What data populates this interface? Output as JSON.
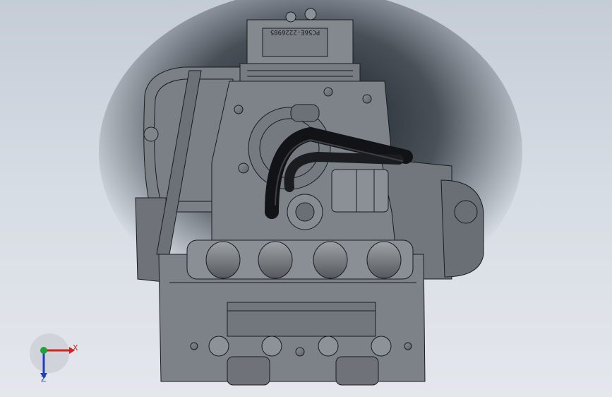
{
  "viewport": {
    "part_label": "PC56E-2226985"
  },
  "triad": {
    "x_label": "X",
    "z_label": "Z",
    "colors": {
      "x": "#d42222",
      "y": "#1fa33a",
      "z": "#1f3fbf"
    }
  }
}
